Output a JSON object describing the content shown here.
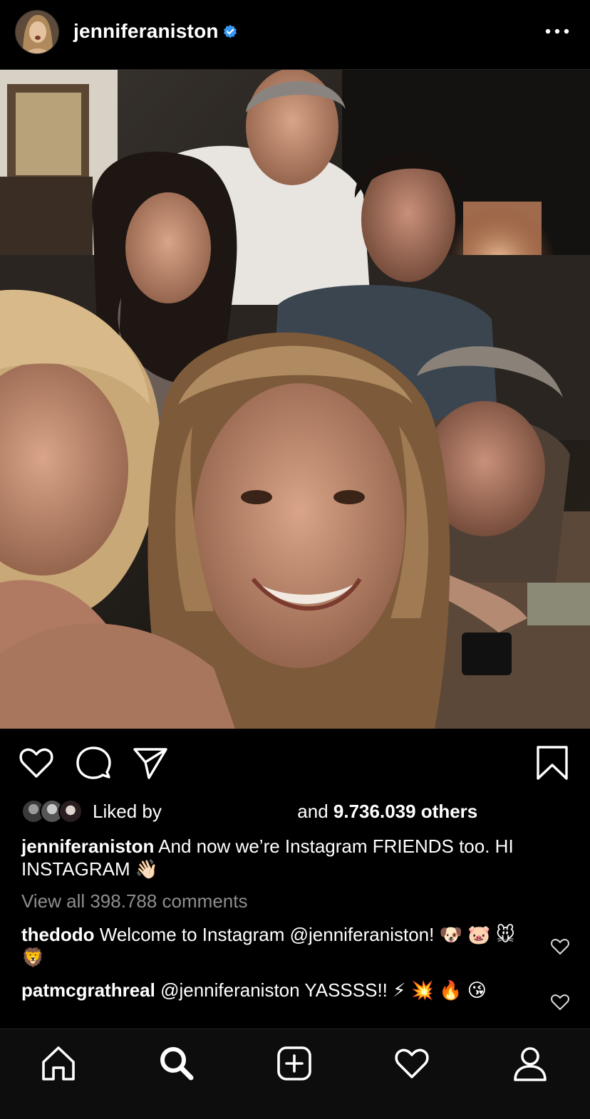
{
  "header": {
    "username": "jenniferaniston",
    "verified_icon": "verified-badge-icon",
    "more_icon": "more-options-icon"
  },
  "actions": {
    "like_icon": "heart-outline-icon",
    "comment_icon": "comment-bubble-icon",
    "share_icon": "paper-plane-icon",
    "save_icon": "bookmark-icon"
  },
  "likes": {
    "prefix": "Liked by ",
    "connector": " and ",
    "count_text": "9.736.039 others"
  },
  "caption": {
    "username": "jenniferaniston",
    "text": "And now we’re Instagram FRIENDS too. HI INSTAGRAM 👋🏻"
  },
  "view_all_comments": "View all 398.788 comments",
  "comments": [
    {
      "username": "thedodo",
      "text": "Welcome to Instagram @jenniferaniston! 🐶 🐷 🐭 🦁"
    },
    {
      "username": "patmcgrathreal",
      "text": "@jenniferaniston YASSSS!! ⚡ 💥 🔥 😘"
    }
  ],
  "tabbar": {
    "items": [
      "home-icon",
      "search-icon",
      "new-post-icon",
      "activity-heart-icon",
      "profile-icon"
    ],
    "active": "search-icon"
  },
  "colors": {
    "background": "#000000",
    "muted_text": "#8e8e8e",
    "verified_blue": "#3897f0"
  }
}
